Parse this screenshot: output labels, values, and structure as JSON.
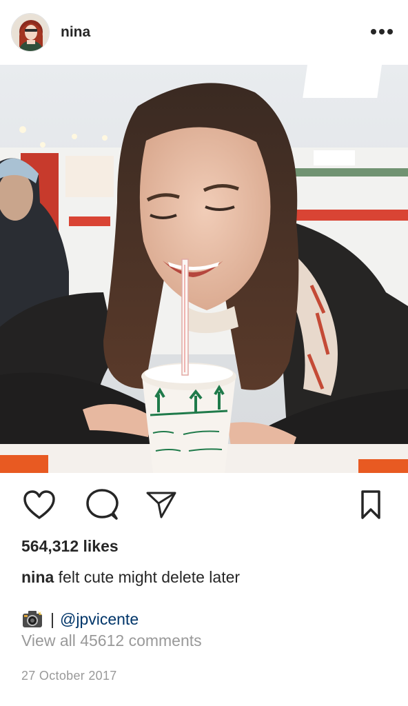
{
  "post": {
    "username": "nina",
    "likes": "564,312 likes",
    "caption_user": "nina",
    "caption_text": " felt cute might delete later",
    "credit_separator": "|",
    "credit_mention": "@jpvicente",
    "view_all_comments": "View all 45612 comments",
    "date": "27 October 2017"
  },
  "icons": {
    "more": "more-options-icon",
    "like": "heart-icon",
    "comment": "comment-bubble-icon",
    "share": "paper-plane-icon",
    "save": "bookmark-icon",
    "credit": "camera-icon"
  },
  "colors": {
    "text": "#262626",
    "muted": "#999999",
    "link": "#003569",
    "background": "#ffffff"
  }
}
